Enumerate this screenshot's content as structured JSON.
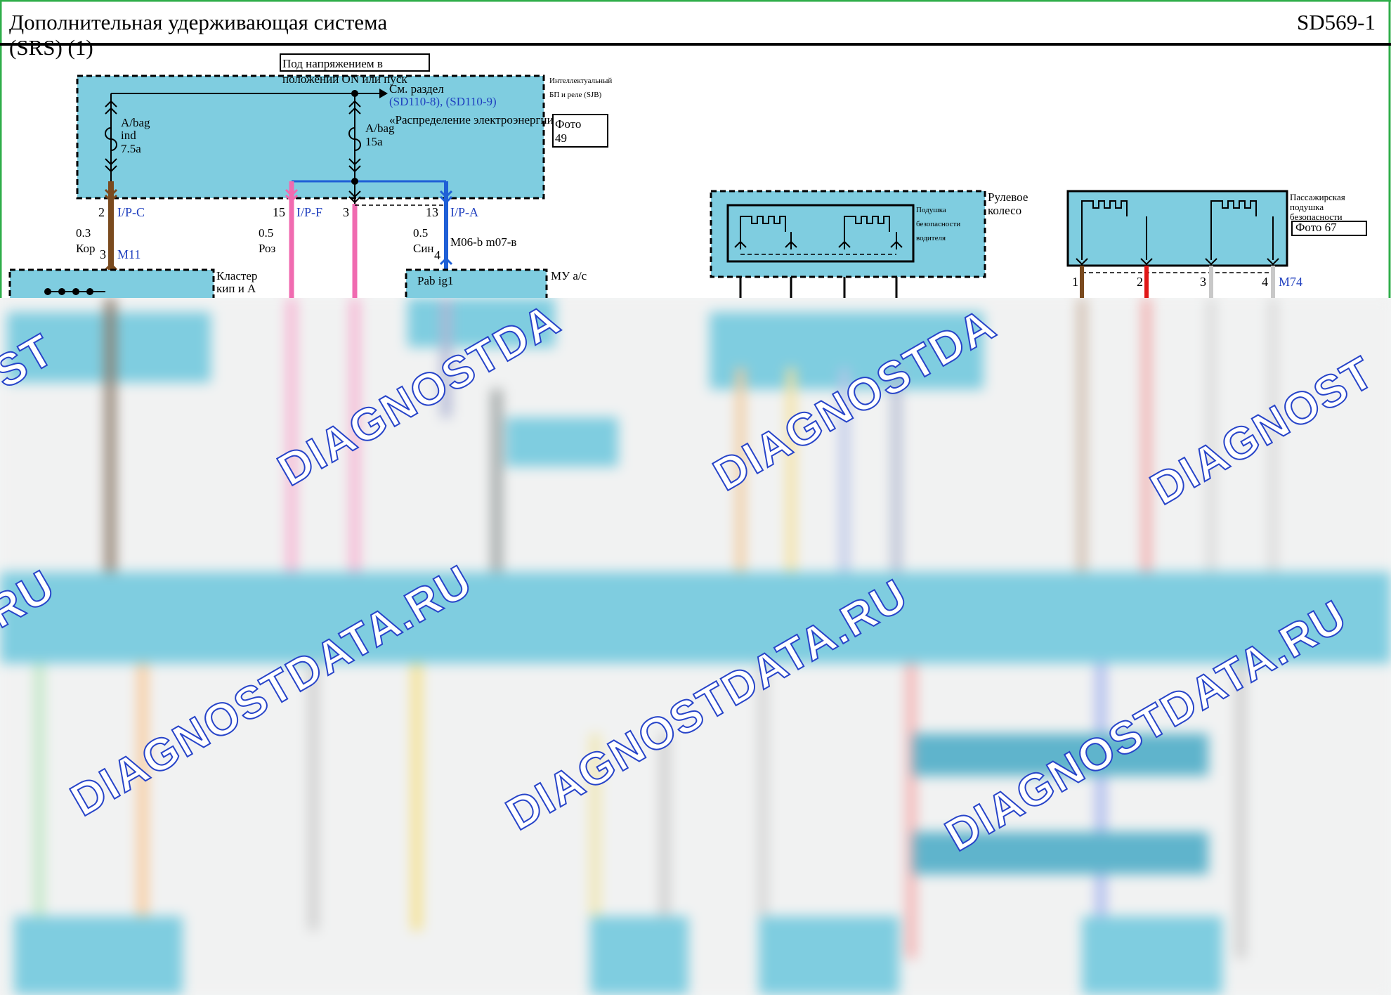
{
  "page": {
    "title_line1": "Дополнительная удерживающая система",
    "title_line2": "(SRS) (1)",
    "code": "SD569-1"
  },
  "colors": {
    "module_fill": "#7fcde0",
    "brown_wire": "#7a4a1e",
    "pink_wire": "#f06bb0",
    "blue_wire": "#1f5fd6",
    "red_wire": "#e01818",
    "gray_wire": "#c8c8c8",
    "frame_green": "#2fae4a",
    "watermark": "#2744c9"
  },
  "sjb": {
    "name_line1": "Интеллектуальный",
    "name_line2": "БП и реле (SJB)",
    "photo_line1": "Фото",
    "photo_line2": "49",
    "power_note": "Под напряжением в положении ON или пуск",
    "see_section": "См. раздел",
    "see_section_detail": "«Распределение электроэнергии»",
    "see_section_refs": "(SD110-8), (SD110-9)",
    "fuse1_line1": "A/bag",
    "fuse1_line2": "ind",
    "fuse1_line3": "7.5a",
    "fuse2_line1": "A/bag",
    "fuse2_line2": "15a"
  },
  "wires": [
    {
      "pin": "2",
      "connector": "I/P-C",
      "gauge": "0.3",
      "color_name": "Кор"
    },
    {
      "pin": "15",
      "connector": "I/P-F",
      "gauge": "0.5",
      "color_name": "Роз"
    },
    {
      "pin": "3",
      "connector": "",
      "gauge": "",
      "color_name": ""
    },
    {
      "pin": "13",
      "connector": "I/P-A",
      "gauge": "0.5",
      "color_name": "Син"
    }
  ],
  "cluster": {
    "pin": "3",
    "connector": "M11",
    "name_line1": "Кластер",
    "name_line2": "кип и А"
  },
  "acu": {
    "pin": "4",
    "connector_ref": "M06-b m07-в",
    "label": "Pab ig1",
    "name": "МУ а/с"
  },
  "steering": {
    "name_line1": "Рулевое",
    "name_line2": "колесо",
    "airbag_line1": "Подушка",
    "airbag_line2": "безопасности",
    "airbag_line3": "водителя"
  },
  "passenger": {
    "name_line1": "Пассажирская",
    "name_line2": "подушка",
    "name_line3": "безопасности",
    "photo": "Фото 67",
    "pins": [
      "1",
      "2",
      "3",
      "4"
    ],
    "connector": "M74"
  },
  "watermark": {
    "text_a": "DIAGNOSTDATA.RU",
    "text_b": "DIAGNOST",
    "text_c": ".RU",
    "text_d": "OST",
    "text_e": "DIAGNOSTDA"
  }
}
